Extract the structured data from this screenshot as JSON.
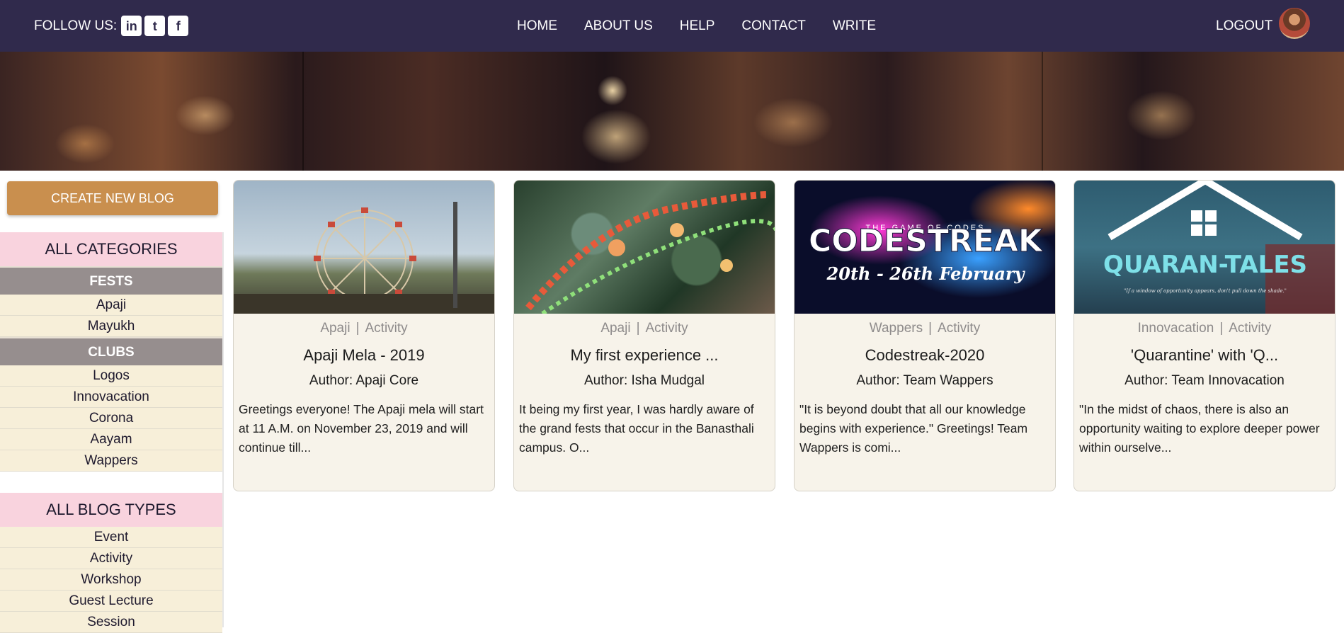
{
  "nav": {
    "follow_label": "FOLLOW US:",
    "social": [
      {
        "icon": "linkedin-icon",
        "glyph": "in"
      },
      {
        "icon": "twitter-icon",
        "glyph": "t"
      },
      {
        "icon": "facebook-icon",
        "glyph": "f"
      }
    ],
    "links": [
      "HOME",
      "ABOUT US",
      "HELP",
      "CONTACT",
      "WRITE"
    ],
    "logout": "LOGOUT"
  },
  "sidebar": {
    "create_button": "CREATE NEW BLOG",
    "categories_title": "ALL CATEGORIES",
    "fests_label": "FESTS",
    "fests": [
      "Apaji",
      "Mayukh"
    ],
    "clubs_label": "CLUBS",
    "clubs": [
      "Logos",
      "Innovacation",
      "Corona",
      "Aayam",
      "Wappers"
    ],
    "blog_types_title": "ALL BLOG TYPES",
    "blog_types": [
      "Event",
      "Activity",
      "Workshop",
      "Guest Lecture",
      "Session"
    ]
  },
  "cards": [
    {
      "category": "Apaji",
      "type": "Activity",
      "title": "Apaji Mela - 2019",
      "author": "Author: Apaji Core",
      "excerpt": "Greetings everyone! The Apaji mela will start at 11 A.M. on November 23, 2019 and will continue till..."
    },
    {
      "category": "Apaji",
      "type": "Activity",
      "title": "My first experience ...",
      "author": "Author: Isha Mudgal",
      "excerpt": "It being my first year, I was hardly aware of the grand fests that occur in the Banasthali campus. O..."
    },
    {
      "category": "Wappers",
      "type": "Activity",
      "title": "Codestreak-2020",
      "author": "Author: Team Wappers",
      "excerpt": "\"It is beyond doubt that all our knowledge begins with experience.\" Greetings! Team Wappers is comi...",
      "image_text": {
        "main": "CODESTREAK",
        "sub": "THE GAME OF CODES",
        "dates": "20th - 26th February"
      }
    },
    {
      "category": "Innovacation",
      "type": "Activity",
      "title": "'Quarantine' with 'Q...",
      "author": "Author: Team Innovacation",
      "excerpt": "\"In the midst of chaos, there is also an opportunity waiting to explore deeper power within ourselve...",
      "image_text": {
        "main": "QUARAN-TALES",
        "sub": "\"If a window of opportunity appears, don't pull down the shade.\""
      }
    }
  ]
}
